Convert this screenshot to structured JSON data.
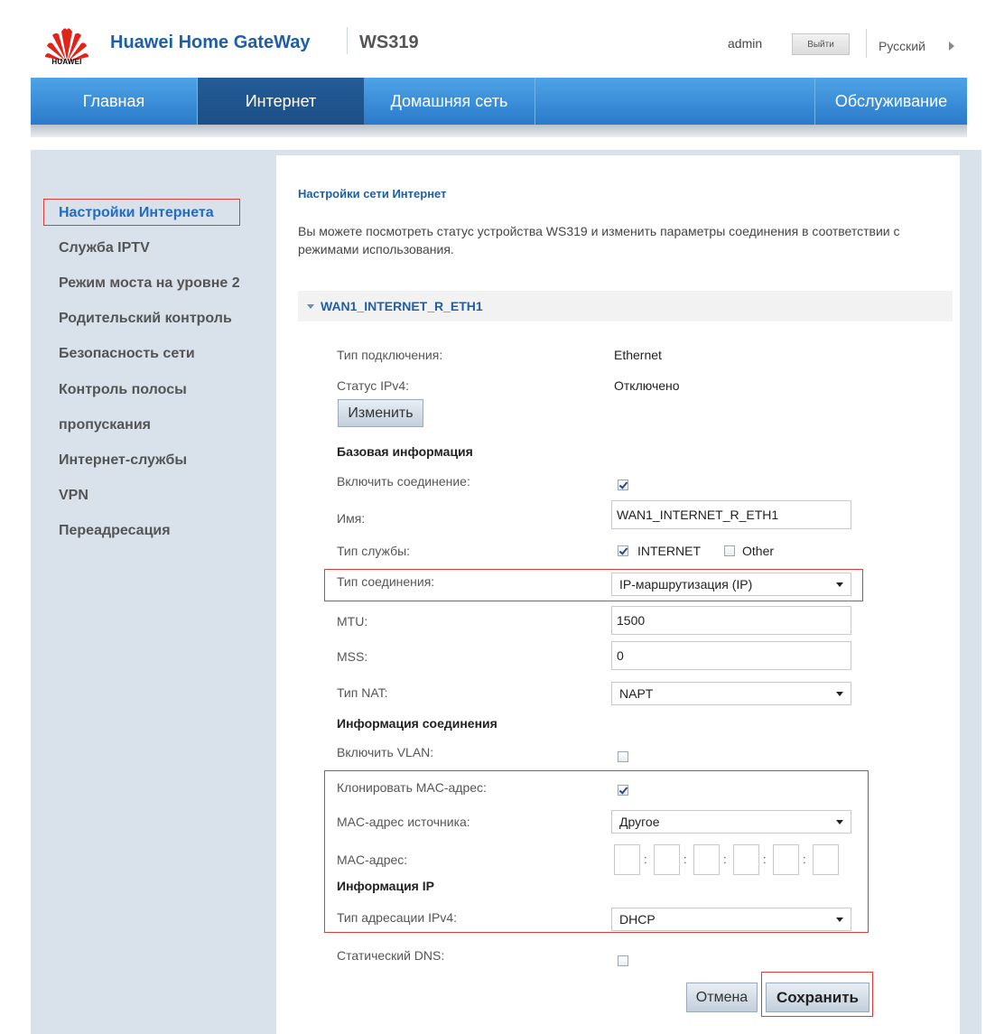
{
  "header": {
    "logo_text": "HUAWEI",
    "brand": "Huawei Home GateWay",
    "model": "WS319",
    "user": "admin",
    "logout_label": "Выйти",
    "language": "Русский"
  },
  "nav": {
    "items": [
      {
        "label": "Главная"
      },
      {
        "label": "Интернет"
      },
      {
        "label": "Домашняя сеть"
      },
      {
        "label": "Обслуживание"
      }
    ]
  },
  "sidebar": {
    "items": [
      {
        "label": "Настройки Интернета"
      },
      {
        "label": "Служба IPTV"
      },
      {
        "label": "Режим моста на уровне 2"
      },
      {
        "label": "Родительский контроль"
      },
      {
        "label": "Безопасность сети"
      },
      {
        "label": "Контроль полосы"
      },
      {
        "label": "пропускания"
      },
      {
        "label": "Интернет-службы"
      },
      {
        "label": "VPN"
      },
      {
        "label": "Переадресация"
      }
    ]
  },
  "main": {
    "title": "Настройки сети Интернет",
    "description": "Вы можете посмотреть статус устройства WS319 и изменить параметры соединения в соответствии с режимами использования.",
    "wan_name": "WAN1_INTERNET_R_ETH1",
    "connection_type_label": "Тип подключения:",
    "connection_type_value": "Ethernet",
    "ipv4_status_label": "Статус IPv4:",
    "ipv4_status_value": "Отключено",
    "change_button": "Изменить",
    "basic_info": "Базовая информация",
    "enable_connection_label": "Включить соединение:",
    "enable_connection": true,
    "name_label": "Имя:",
    "name_value": "WAN1_INTERNET_R_ETH1",
    "service_type_label": "Тип службы:",
    "service_internet": "INTERNET",
    "service_internet_checked": true,
    "service_other": "Other",
    "service_other_checked": false,
    "conn_mode_label": "Тип соединения:",
    "conn_mode_value": "IP-маршрутизация (IP)",
    "mtu_label": "MTU:",
    "mtu_value": "1500",
    "mss_label": "MSS:",
    "mss_value": "0",
    "nat_label": "Тип NAT:",
    "nat_value": "NAPT",
    "conn_info": "Информация соединения",
    "vlan_label": "Включить VLAN:",
    "vlan_checked": false,
    "clone_mac_label": "Клонировать MAC-адрес:",
    "clone_mac_checked": true,
    "mac_source_label": "MAC-адрес источника:",
    "mac_source_value": "Другое",
    "mac_label": "MAC-адрес:",
    "mac_separator": ":",
    "ip_info": "Информация IP",
    "ipv4_addr_label": "Тип адресации IPv4:",
    "ipv4_addr_value": "DHCP",
    "static_dns_label": "Статический DNS:",
    "static_dns_checked": false,
    "cancel_button": "Отмена",
    "save_button": "Сохранить"
  },
  "colors": {
    "nav_blue": "#2a7ac9",
    "nav_active": "#1c4f86",
    "brand_blue": "#1f5fa6",
    "highlight_red": "#e03a3a",
    "sidebar_bg": "#d9e1eb"
  }
}
